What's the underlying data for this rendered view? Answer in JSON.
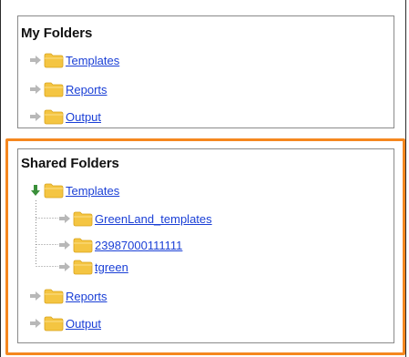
{
  "my_folders": {
    "title": "My Folders",
    "items": [
      {
        "label": "Templates",
        "expanded": false
      },
      {
        "label": "Reports",
        "expanded": false
      },
      {
        "label": "Output",
        "expanded": false
      }
    ]
  },
  "shared_folders": {
    "title": "Shared Folders",
    "items": [
      {
        "label": "Templates",
        "expanded": true,
        "children": [
          {
            "label": "GreenLand_templates"
          },
          {
            "label": "23987000111111"
          },
          {
            "label": "tgreen"
          }
        ]
      },
      {
        "label": "Reports",
        "expanded": false
      },
      {
        "label": "Output",
        "expanded": false
      }
    ]
  },
  "colors": {
    "highlight": "#f5871f",
    "link": "#1a3fd6",
    "arrow_collapsed": "#b8b8b8",
    "arrow_expanded": "#3a8f3a",
    "folder": "#f4c542"
  },
  "icons": {
    "collapsed_arrow": "arrow-right-icon",
    "expanded_arrow": "arrow-down-icon",
    "folder": "folder-icon"
  }
}
